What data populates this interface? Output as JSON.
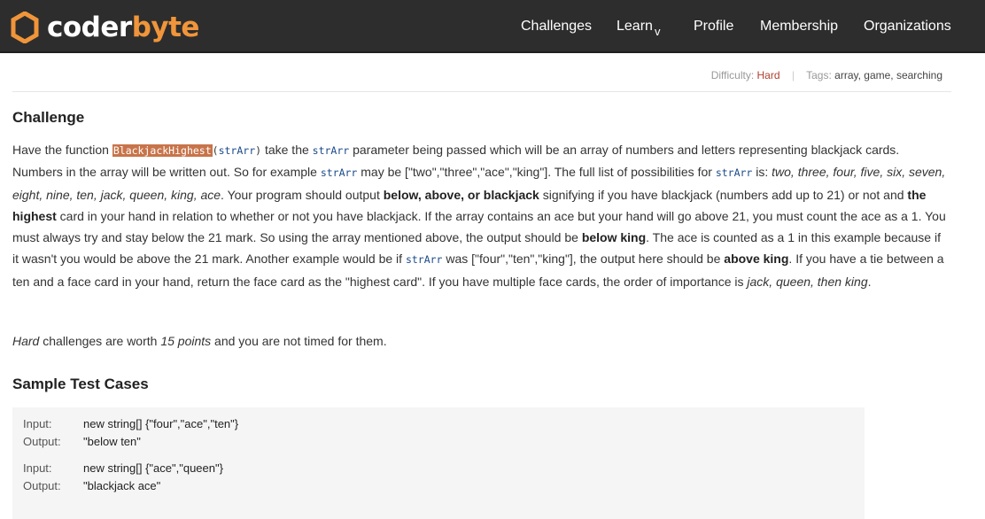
{
  "brand": {
    "name_part1": "coder",
    "name_part2": "byte",
    "colors": {
      "accent": "#f0953a",
      "header_bg": "#2d2d2d"
    }
  },
  "nav": {
    "challenges": "Challenges",
    "learn": "Learn",
    "learn_caret": "v",
    "profile": "Profile",
    "membership": "Membership",
    "organizations": "Organizations"
  },
  "meta": {
    "difficulty_label": "Difficulty:",
    "difficulty_value": "Hard",
    "separator": "|",
    "tags_label": "Tags:",
    "tags_value": "array, game, searching"
  },
  "challenge": {
    "heading": "Challenge",
    "p1": "Have the function ",
    "fn_name": "BlackjackHighest",
    "fn_args_open": "(",
    "fn_param": "strArr",
    "fn_args_close": ")",
    "p2": " take the ",
    "param1": "strArr",
    "p3": " parameter being passed which will be an array of numbers and letters representing blackjack cards. Numbers in the array will be written out. So for example ",
    "param2": "strArr",
    "p4": " may be [\"two\",\"three\",\"ace\",\"king\"]. The full list of possibilities for ",
    "param3": "strArr",
    "p5": " is: ",
    "list_italic": "two, three, four, five, six, seven, eight, nine, ten, jack, queen, king, ace",
    "p6": ". Your program should output ",
    "bold1": "below, above, or blackjack",
    "p7": " signifying if you have blackjack (numbers add up to 21) or not and ",
    "bold2": "the highest",
    "p8": " card in your hand in relation to whether or not you have blackjack. If the array contains an ace but your hand will go above 21, you must count the ace as a 1. You must always try and stay below the 21 mark. So using the array mentioned above, the output should be ",
    "bold3": "below king",
    "p9": ". The ace is counted as a 1 in this example because if it wasn't you would be above the 21 mark. Another example would be if ",
    "param4": "strArr",
    "p10": " was [\"four\",\"ten\",\"king\"], the output here should be ",
    "bold4": "above king",
    "p11": ". If you have a tie between a ten and a face card in your hand, return the face card as the \"highest card\". If you have multiple face cards, the order of importance is ",
    "order_italic": "jack, queen, then king",
    "p12": "."
  },
  "note": {
    "italic1": "Hard",
    "text1": " challenges are worth ",
    "italic2": "15 points",
    "text2": " and you are not timed for them."
  },
  "samples": {
    "heading": "Sample Test Cases",
    "input_label": "Input:",
    "output_label": "Output:",
    "cases": [
      {
        "input": "new string[] {\"four\",\"ace\",\"ten\"}",
        "output": "\"below ten\""
      },
      {
        "input": "new string[] {\"ace\",\"queen\"}",
        "output": "\"blackjack ace\""
      }
    ]
  }
}
